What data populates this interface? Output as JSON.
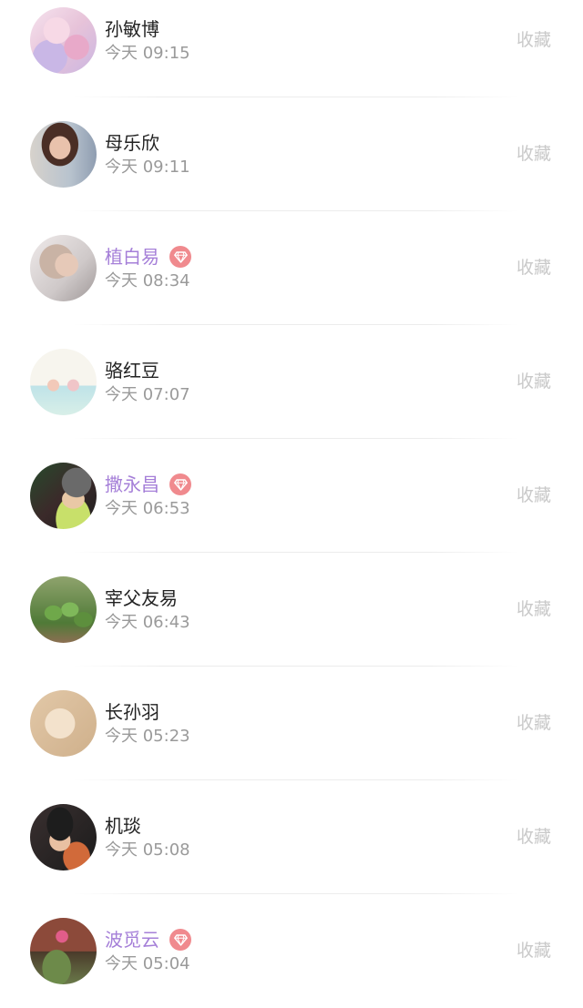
{
  "contacts": [
    {
      "name": "孙敏博",
      "time": "今天 09:15",
      "vip": false,
      "action": "收藏",
      "avatar": "pink-illustration"
    },
    {
      "name": "母乐欣",
      "time": "今天 09:11",
      "vip": false,
      "action": "收藏",
      "avatar": "woman-portrait"
    },
    {
      "name": "植白易",
      "time": "今天 08:34",
      "vip": true,
      "action": "收藏",
      "avatar": "woman-arm-raised"
    },
    {
      "name": "骆红豆",
      "time": "今天 07:07",
      "vip": false,
      "action": "收藏",
      "avatar": "drawing-two-girls"
    },
    {
      "name": "撒永昌",
      "time": "今天 06:53",
      "vip": true,
      "action": "收藏",
      "avatar": "girl-knit-hat"
    },
    {
      "name": "宰父友易",
      "time": "今天 06:43",
      "vip": false,
      "action": "收藏",
      "avatar": "cactus"
    },
    {
      "name": "长孙羽",
      "time": "今天 05:23",
      "vip": false,
      "action": "收藏",
      "avatar": "cat"
    },
    {
      "name": "机琰",
      "time": "今天 05:08",
      "vip": false,
      "action": "收藏",
      "avatar": "man-food"
    },
    {
      "name": "波觅云",
      "time": "今天 05:04",
      "vip": true,
      "action": "收藏",
      "avatar": "flower-pot"
    }
  ],
  "colors": {
    "vip_name": "#a57fd8",
    "vip_badge": "#f08a8e",
    "time": "#9a9a9a",
    "action": "#c9c9c9"
  },
  "icons": {
    "vip": "diamond-icon"
  }
}
